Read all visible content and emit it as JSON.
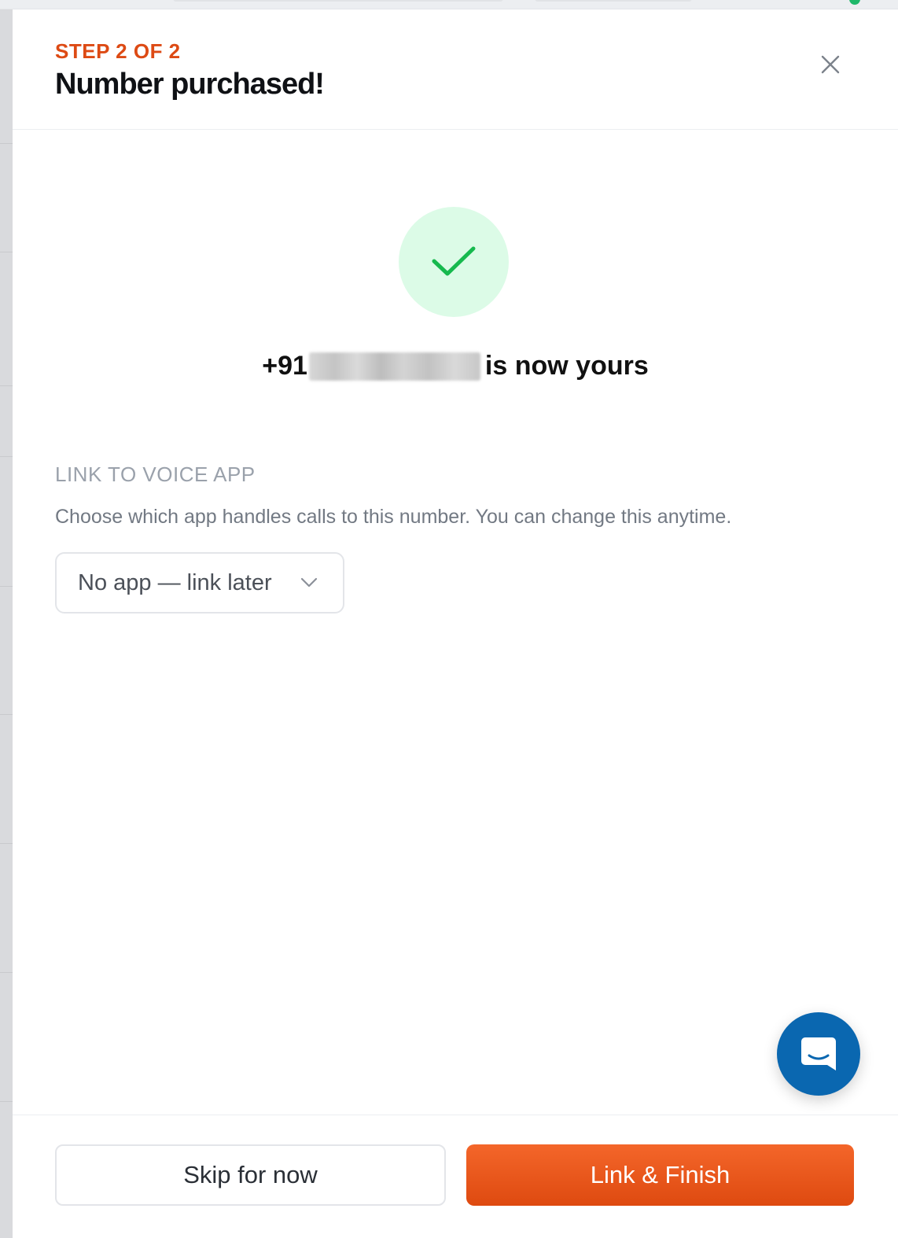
{
  "drawer": {
    "step_label": "STEP 2 OF 2",
    "title": "Number purchased!",
    "close_icon": "close-icon"
  },
  "success": {
    "icon": "checkmark-icon",
    "phone_prefix": "+91",
    "phone_rest_hidden": "redacted",
    "suffix": "is now yours"
  },
  "link_section": {
    "label": "LINK TO VOICE APP",
    "description": "Choose which app handles calls to this number. You can change this anytime.",
    "select_value": "No app — link later",
    "select_icon": "chevron-down-icon"
  },
  "chat": {
    "icon": "chat-bubble-icon"
  },
  "footer": {
    "skip_label": "Skip for now",
    "finish_label": "Link & Finish"
  },
  "colors": {
    "accent": "#dd4a14",
    "success_bg": "#dcfbe7",
    "success_check": "#16b94e",
    "chat_bg": "#0a67b0"
  }
}
